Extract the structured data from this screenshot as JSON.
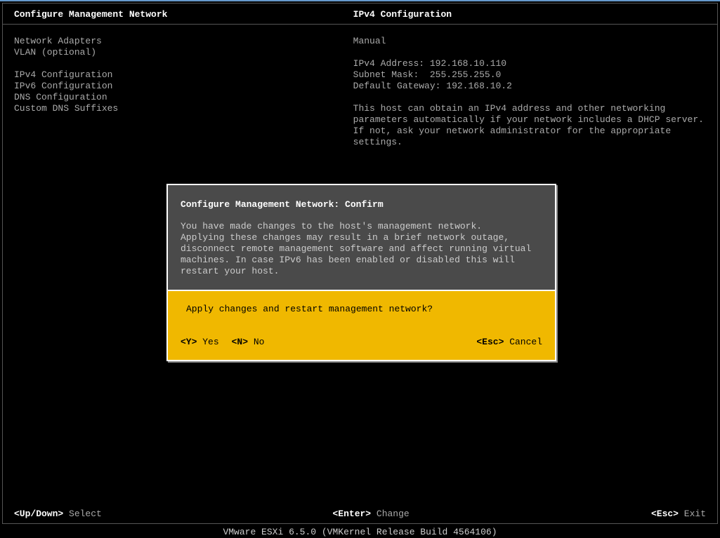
{
  "header": {
    "left": "Configure Management Network",
    "right": "IPv4 Configuration"
  },
  "menu": {
    "items_a": [
      "Network Adapters",
      "VLAN (optional)"
    ],
    "items_b": [
      "IPv4 Configuration",
      "IPv6 Configuration",
      "DNS Configuration",
      "Custom DNS Suffixes"
    ]
  },
  "info": {
    "mode": "Manual",
    "ipv4_label": "IPv4 Address:",
    "ipv4": "192.168.10.110",
    "mask_label": "Subnet Mask:",
    "mask": "255.255.255.0",
    "gw_label": "Default Gateway:",
    "gw": "192.168.10.2",
    "para": "This host can obtain an IPv4 address and other networking parameters automatically if your network includes a DHCP server. If not, ask your network administrator for the appropriate settings."
  },
  "footer": {
    "left_key": "<Up/Down>",
    "left_text": "Select",
    "center_key": "<Enter>",
    "center_text": "Change",
    "right_key": "<Esc>",
    "right_text": "Exit"
  },
  "bottom": "VMware ESXi 6.5.0 (VMKernel Release Build 4564106)",
  "dialog": {
    "title": "Configure Management Network: Confirm",
    "msg_l1": "You have made changes to the host's management network.",
    "msg_l2": "Applying these changes may result in a brief network outage, disconnect remote management software and affect running virtual machines. In case IPv6 has been enabled or disabled this will restart your host.",
    "question": "Apply changes and restart management network?",
    "yes_key": "<Y>",
    "yes_text": "Yes",
    "no_key": "<N>",
    "no_text": "No",
    "cancel_key": "<Esc>",
    "cancel_text": "Cancel"
  }
}
